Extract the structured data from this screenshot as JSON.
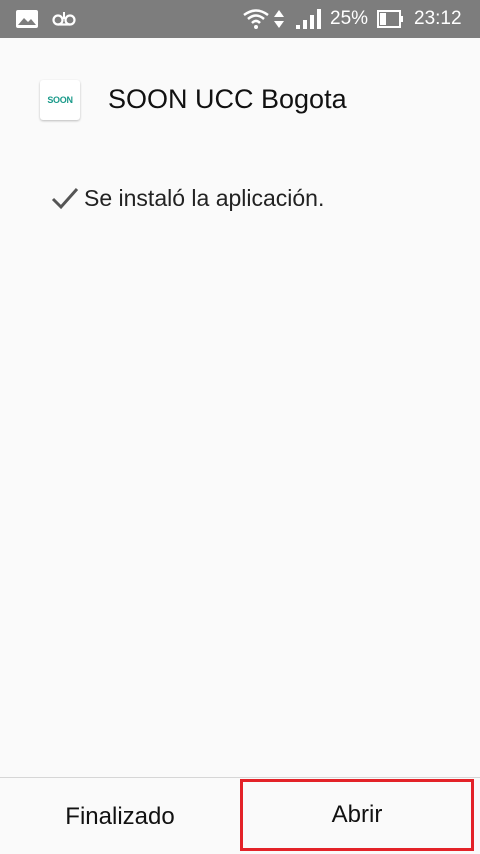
{
  "status_bar": {
    "left_icons": [
      "image-icon",
      "voicemail-icon"
    ],
    "right_icons": [
      "wifi-icon",
      "data-arrows-icon",
      "signal-icon",
      "battery-icon"
    ],
    "battery": "25%",
    "time": "23:12"
  },
  "app": {
    "icon_text": "SOON",
    "title": "SOON UCC Bogota"
  },
  "install": {
    "icon": "check-icon",
    "message": "Se instaló la aplicación."
  },
  "actions": {
    "done_label": "Finalizado",
    "open_label": "Abrir",
    "highlight_color": "#e32228"
  }
}
